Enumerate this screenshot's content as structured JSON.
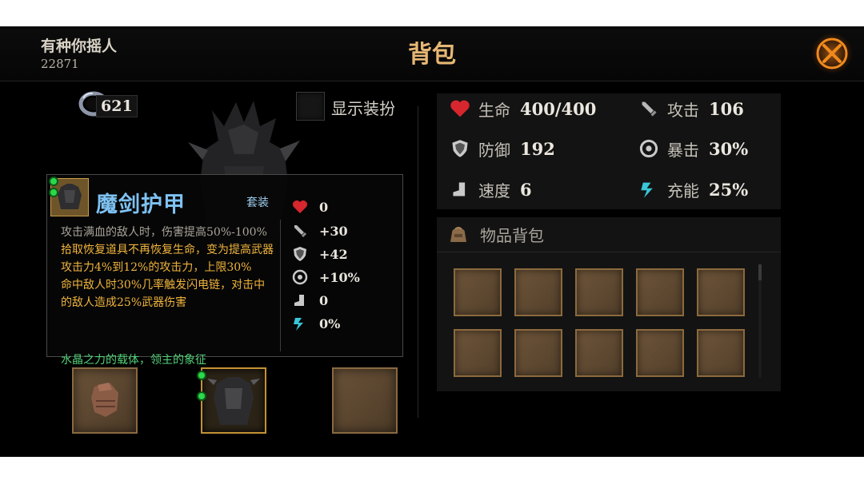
{
  "header": {
    "player_name": "有种你摇人",
    "player_id": "22871",
    "title": "背包",
    "close_icon": "close-x-icon",
    "accent": "#e6b774"
  },
  "currency": {
    "icon": "crystal-gem-icon",
    "value": "621"
  },
  "outfit_toggle": {
    "label": "显示装扮",
    "checked": false
  },
  "tooltip": {
    "item_name": "魔剑护甲",
    "set_label": "套装",
    "description": [
      "攻击满血的敌人时，伤害提高50%-100%",
      "拾取恢复道具不再恢复生命，变为提高武器攻击力4%到12%的攻击力，上限30%",
      "命中敌人时30%几率触发闪电链，对击中的敌人造成25%武器伤害"
    ],
    "flavor": "水晶之力的载体，领主的象征",
    "stats": [
      {
        "icon": "heart-icon",
        "value": "0"
      },
      {
        "icon": "sword-icon",
        "value": "+30"
      },
      {
        "icon": "shield-icon",
        "value": "+42"
      },
      {
        "icon": "crit-icon",
        "value": "+10%"
      },
      {
        "icon": "boot-icon",
        "value": "0"
      },
      {
        "icon": "energy-icon",
        "value": "0%"
      }
    ]
  },
  "equip_slots": [
    {
      "item": "gauntlet",
      "gems": 0
    },
    {
      "item": "demon-sword-armor",
      "gems": 2
    },
    {
      "item": "empty",
      "gems": 0
    }
  ],
  "stats": [
    {
      "icon": "heart-icon",
      "label": "生命",
      "value": "400/400"
    },
    {
      "icon": "sword-icon",
      "label": "攻击",
      "value": "106"
    },
    {
      "icon": "shield-icon",
      "label": "防御",
      "value": "192"
    },
    {
      "icon": "crit-icon",
      "label": "暴击",
      "value": "30%"
    },
    {
      "icon": "boot-icon",
      "label": "速度",
      "value": "6"
    },
    {
      "icon": "energy-icon",
      "label": "充能",
      "value": "25%"
    }
  ],
  "bag": {
    "title": "物品背包",
    "icon": "bag-icon",
    "slots": [
      "empty",
      "empty",
      "empty",
      "empty",
      "empty",
      "empty",
      "empty",
      "empty",
      "empty",
      "empty"
    ]
  }
}
